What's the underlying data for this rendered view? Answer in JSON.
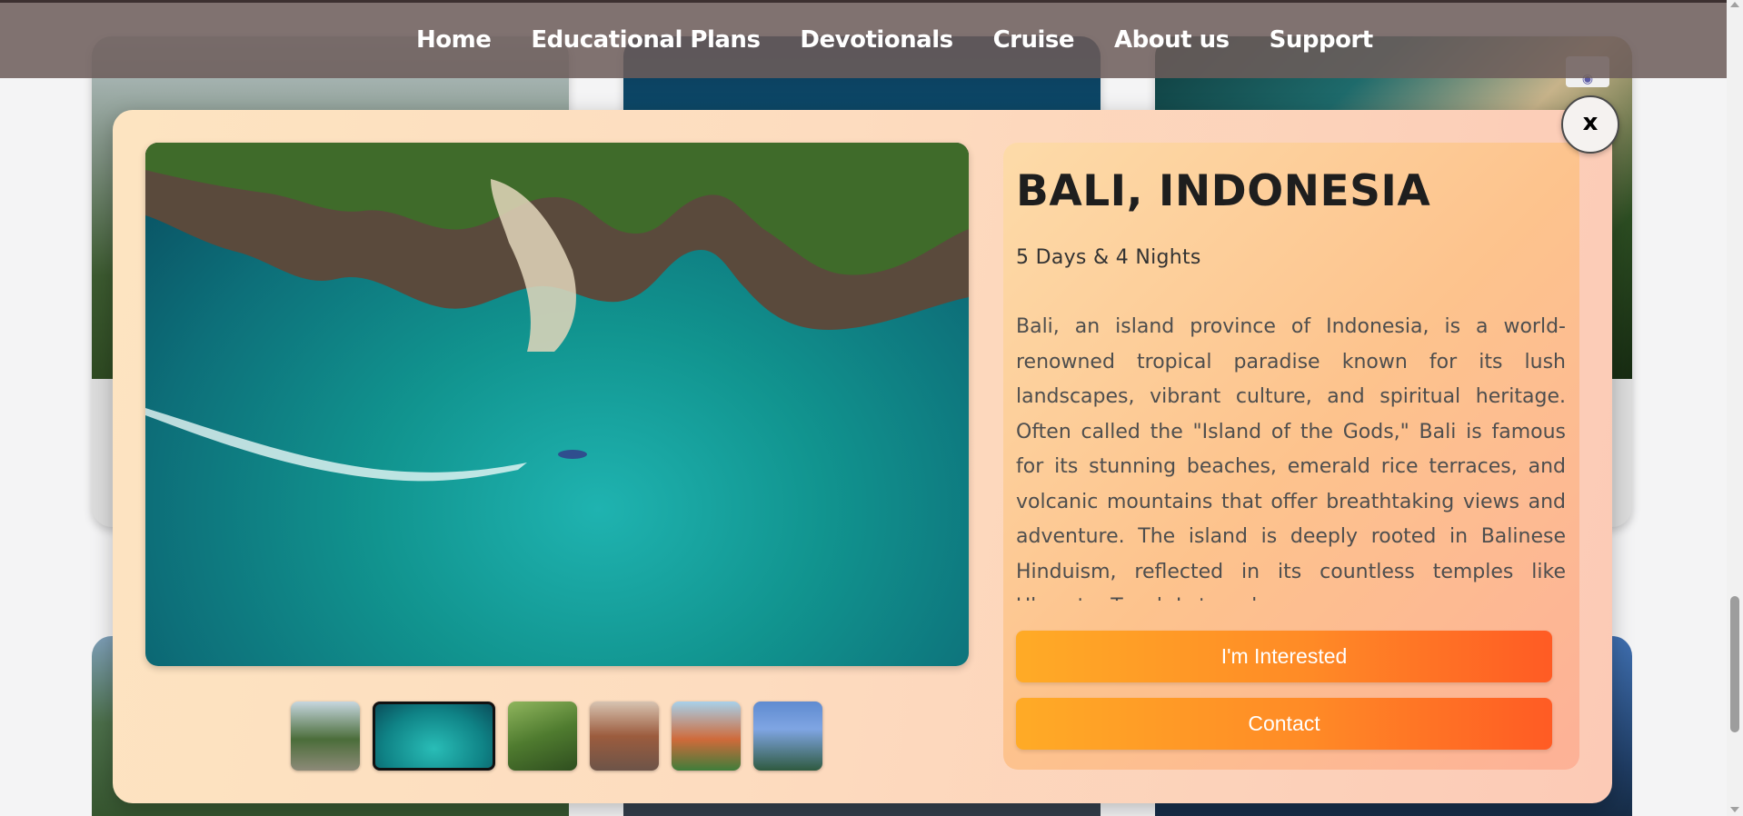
{
  "nav": {
    "items": [
      {
        "label": "Home"
      },
      {
        "label": "Educational Plans"
      },
      {
        "label": "Devotionals"
      },
      {
        "label": "Cruise"
      },
      {
        "label": "About us"
      },
      {
        "label": "Support"
      }
    ]
  },
  "modal": {
    "close_label": "x",
    "title": "BALI, INDONESIA",
    "duration": "5 Days & 4 Nights",
    "description": "Bali, an island province of Indonesia, is a world-renowned tropical paradise known for its lush landscapes, vibrant culture, and spiritual heritage. Often called the \"Island of the Gods,\" Bali is famous for its stunning beaches, emerald rice terraces, and volcanic mountains that offer breathtaking views and adventure. The island is deeply rooted in Balinese Hinduism, reflected in its countless temples like Uluwatu, Tanah Lot, and",
    "buttons": {
      "interested": "I'm Interested",
      "contact": "Contact"
    },
    "thumbnails": {
      "count": 6,
      "active_index": 1
    }
  },
  "colors": {
    "nav_bg": "#6c5c5a",
    "button_gradient_start": "#ffab26",
    "button_gradient_end": "#ff5b24",
    "title_text": "#1e1e1e"
  }
}
